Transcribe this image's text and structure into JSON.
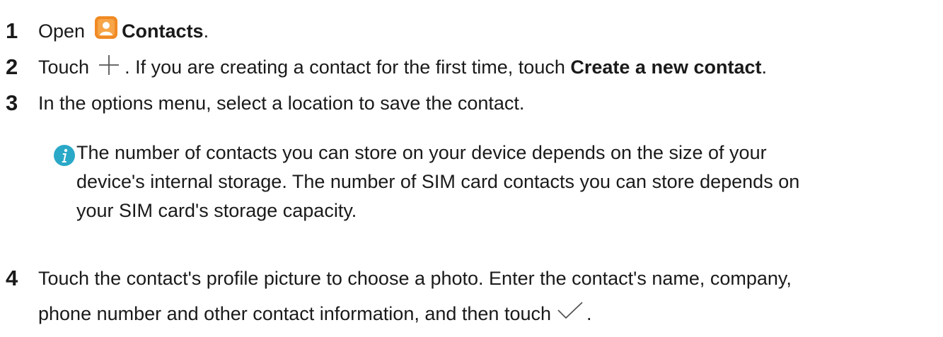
{
  "steps": [
    {
      "number": "1",
      "text_before": "Open",
      "bold": "Contacts",
      "text_after": "."
    },
    {
      "number": "2",
      "text_before": "Touch",
      "text_middle": ". If you are creating a contact for the first time, touch",
      "bold": "Create a new contact",
      "text_after": "."
    },
    {
      "number": "3",
      "text": "In the options menu, select a location to save the contact."
    },
    {
      "number": "4",
      "line1": "Touch the contact's profile picture to choose a photo. Enter the contact's name, company,",
      "line2": "phone number and other contact information, and then touch",
      "text_after": "."
    }
  ],
  "note": {
    "line1": "The number of contacts you can store on your device depends on the size of your",
    "line2": "device's internal storage. The number of SIM card contacts you can store depends on",
    "line3": "your SIM card's storage capacity."
  },
  "colors": {
    "contacts_icon_bg": "#F08A24",
    "info_icon_bg": "#2AA8C8",
    "text": "#1A1A1A"
  },
  "icons": [
    "contacts-icon",
    "plus-icon",
    "info-icon",
    "check-icon"
  ]
}
